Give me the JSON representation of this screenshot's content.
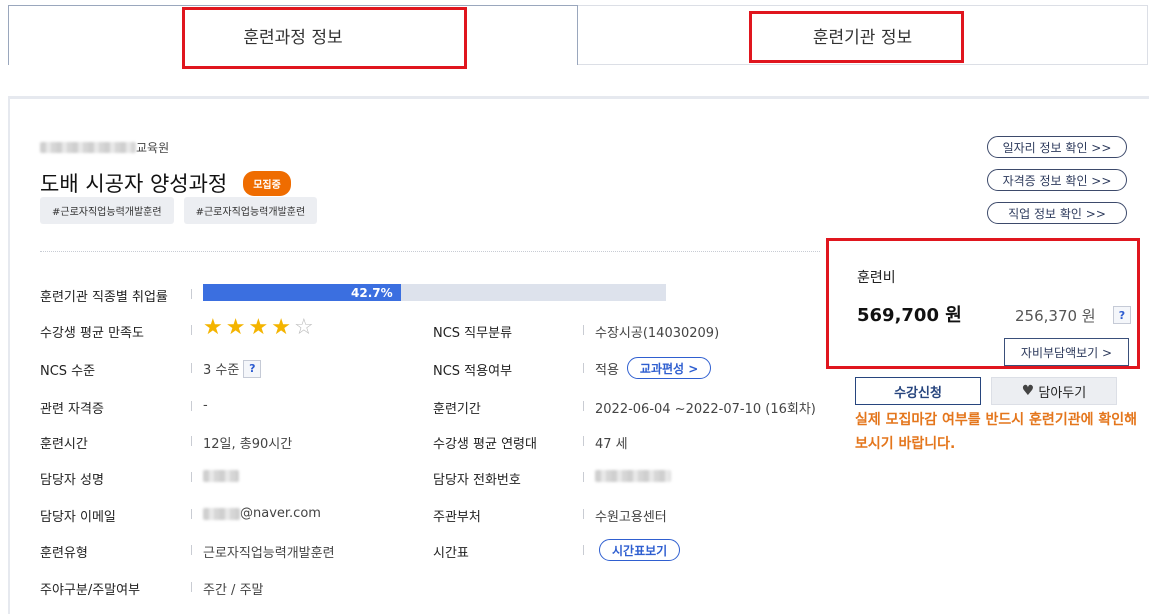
{
  "tabs": {
    "course_info": "훈련과정 정보",
    "institution_info": "훈련기관 정보"
  },
  "course": {
    "institution_suffix": "교육원",
    "title": "도배 시공자 양성과정",
    "status_badge": "모집중",
    "hashtags": [
      "#근로자직업능력개발훈련",
      "#근로자직업능력개발훈련"
    ]
  },
  "links": {
    "job_info": "일자리 정보 확인 >>",
    "cert_info": "자격증 정보 확인 >>",
    "occupation_info": "직업 정보 확인 >>"
  },
  "employment_rate": {
    "label": "훈련기관 직종별 취업률",
    "value_text": "42.7%",
    "value": 42.7
  },
  "satisfaction": {
    "label": "수강생 평균 만족도",
    "stars_full": 4,
    "stars_total": 5
  },
  "left_rows": [
    {
      "label": "NCS 수준",
      "value": "3 수준"
    },
    {
      "label": "관련 자격증",
      "value": "-"
    },
    {
      "label": "훈련시간",
      "value": "12일, 총90시간"
    },
    {
      "label": "담당자 성명",
      "value": ""
    },
    {
      "label": "담당자 이메일",
      "value": "@naver.com"
    },
    {
      "label": "훈련유형",
      "value": "근로자직업능력개발훈련"
    },
    {
      "label": "주야구분/주말여부",
      "value": "주간 / 주말"
    }
  ],
  "right_rows": [
    {
      "label": "NCS 직무분류",
      "value": "수장시공(14030209)"
    },
    {
      "label": "NCS 적용여부",
      "value": "적용",
      "button": "교과편성 >"
    },
    {
      "label": "훈련기간",
      "value": "2022-06-04 ~2022-07-10 (16회차)"
    },
    {
      "label": "수강생 평균 연령대",
      "value": "47 세"
    },
    {
      "label": "담당자 전화번호",
      "value": ""
    },
    {
      "label": "주관부처",
      "value": "수원고용센터"
    },
    {
      "label": "시간표",
      "value": "",
      "button": "시간표보기"
    }
  ],
  "help_mark": "?",
  "fee": {
    "title": "훈련비",
    "total": "569,700 원",
    "self_pay": "256,370 원",
    "self_pay_button": "자비부담액보기 >"
  },
  "actions": {
    "apply": "수강신청",
    "wishlist": "담아두기",
    "notice": "실제 모집마감 여부를 반드시 훈련기관에 확인해보시기 바랍니다."
  },
  "colors": {
    "highlight_red": "#e0161e",
    "badge_orange": "#ef6c00",
    "progress_blue": "#3b6fe0",
    "notice_orange": "#e4761c",
    "star_gold": "#f4b400"
  }
}
